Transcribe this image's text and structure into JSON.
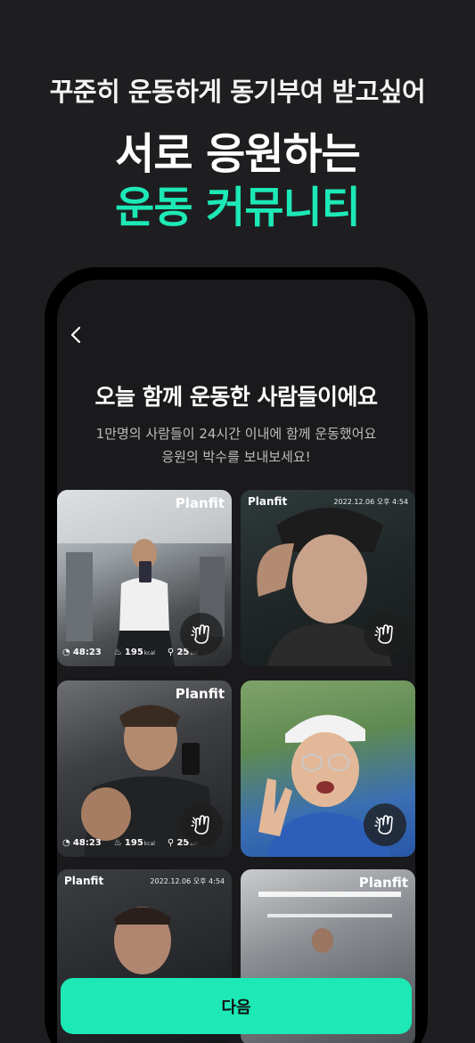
{
  "promo": {
    "subtitle": "꾸준히 운동하게 동기부여 받고싶어",
    "title_line1": "서로 응원하는",
    "title_line2": "운동 커뮤니티"
  },
  "screen": {
    "title": "오늘 함께 운동한 사람들이에요",
    "description_line1": "1만명의 사람들이 24시간 이내에 함께 운동했어요",
    "description_line2": "응원의 박수를 보내보세요!"
  },
  "feed": [
    {
      "brand": "Planfit",
      "time": "48:23",
      "kcal": "195",
      "kcal_unit": "kcal",
      "sets": "25",
      "sets_unit": "set"
    },
    {
      "brand": "Planfit",
      "date": "2022.12.06 오후 4:54"
    },
    {
      "brand": "Planfit",
      "time": "48:23",
      "kcal": "195",
      "kcal_unit": "kcal",
      "sets": "25",
      "sets_unit": "set"
    },
    {},
    {
      "brand": "Planfit",
      "date": "2022.12.06 오후 4:54"
    },
    {
      "brand": "Planfit"
    }
  ],
  "actions": {
    "next_label": "다음"
  },
  "colors": {
    "accent": "#1de9b6",
    "background": "#1e1e20"
  }
}
